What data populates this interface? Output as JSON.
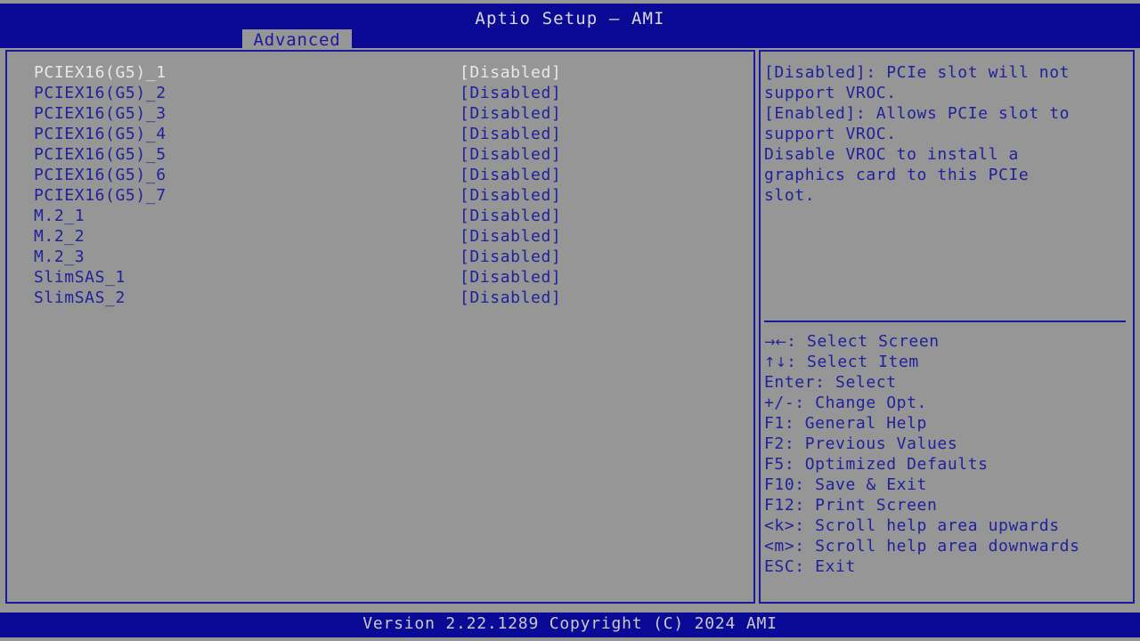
{
  "header": {
    "title": "Aptio Setup – AMI",
    "active_tab": "Advanced",
    "tabs": [
      "Advanced"
    ]
  },
  "settings": {
    "selected_index": 0,
    "rows": [
      {
        "label": "PCIEX16(G5)_1",
        "value": "[Disabled]"
      },
      {
        "label": "PCIEX16(G5)_2",
        "value": "[Disabled]"
      },
      {
        "label": "PCIEX16(G5)_3",
        "value": "[Disabled]"
      },
      {
        "label": "PCIEX16(G5)_4",
        "value": "[Disabled]"
      },
      {
        "label": "PCIEX16(G5)_5",
        "value": "[Disabled]"
      },
      {
        "label": "PCIEX16(G5)_6",
        "value": "[Disabled]"
      },
      {
        "label": "PCIEX16(G5)_7",
        "value": "[Disabled]"
      },
      {
        "label": "M.2_1",
        "value": "[Disabled]"
      },
      {
        "label": "M.2_2",
        "value": "[Disabled]"
      },
      {
        "label": "M.2_3",
        "value": "[Disabled]"
      },
      {
        "label": "SlimSAS_1",
        "value": "[Disabled]"
      },
      {
        "label": "SlimSAS_2",
        "value": "[Disabled]"
      }
    ]
  },
  "help": {
    "lines": [
      "[Disabled]: PCIe slot will not",
      "support VROC.",
      "[Enabled]: Allows PCIe slot to",
      "support VROC.",
      "Disable VROC to install a",
      "graphics card to this PCIe",
      "slot."
    ]
  },
  "key_legend": [
    {
      "glyph": "→←",
      "text": ": Select Screen"
    },
    {
      "glyph": "↑↓",
      "text": ": Select Item"
    },
    {
      "glyph": "",
      "text": "Enter: Select"
    },
    {
      "glyph": "",
      "text": "+/-: Change Opt."
    },
    {
      "glyph": "",
      "text": "F1: General Help"
    },
    {
      "glyph": "",
      "text": "F2: Previous Values"
    },
    {
      "glyph": "",
      "text": "F5: Optimized Defaults"
    },
    {
      "glyph": "",
      "text": "F10: Save & Exit"
    },
    {
      "glyph": "",
      "text": "F12: Print Screen"
    },
    {
      "glyph": "",
      "text": "<k>: Scroll help area upwards"
    },
    {
      "glyph": "",
      "text": "<m>: Scroll help area downwards"
    },
    {
      "glyph": "",
      "text": "ESC: Exit"
    }
  ],
  "footer": {
    "version_text": "Version 2.22.1289 Copyright (C) 2024 AMI"
  },
  "colors": {
    "background": "#969696",
    "bar_blue": "#0a0a96",
    "text_blue": "#21219c",
    "border_blue": "#1a1a9e",
    "selected_text": "#e8e8e8"
  }
}
